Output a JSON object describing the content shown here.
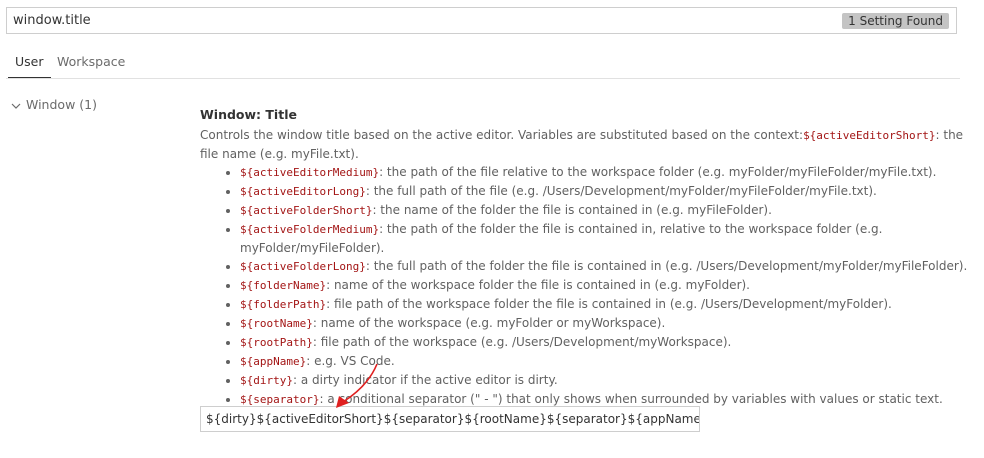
{
  "search": {
    "value": "window.title",
    "result_count": "1 Setting Found"
  },
  "tabs": [
    {
      "label": "User",
      "active": true
    },
    {
      "label": "Workspace",
      "active": false
    }
  ],
  "tree": {
    "label": "Window (1)"
  },
  "setting": {
    "title_prefix": "Window: ",
    "title": "Title",
    "desc_part1": "Controls the window title based on the active editor. Variables are substituted based on the context:",
    "desc_code": "${activeEditorShort}",
    "desc_part2": ": the file name (e.g. myFile.txt).",
    "variables": [
      {
        "code": "${activeEditorMedium}",
        "text": ": the path of the file relative to the workspace folder (e.g. myFolder/myFileFolder/myFile.txt)."
      },
      {
        "code": "${activeEditorLong}",
        "text": ": the full path of the file (e.g. /Users/Development/myFolder/myFileFolder/myFile.txt)."
      },
      {
        "code": "${activeFolderShort}",
        "text": ": the name of the folder the file is contained in (e.g. myFileFolder)."
      },
      {
        "code": "${activeFolderMedium}",
        "text": ": the path of the folder the file is contained in, relative to the workspace folder (e.g. myFolder/myFileFolder)."
      },
      {
        "code": "${activeFolderLong}",
        "text": ": the full path of the folder the file is contained in (e.g. /Users/Development/myFolder/myFileFolder)."
      },
      {
        "code": "${folderName}",
        "text": ": name of the workspace folder the file is contained in (e.g. myFolder)."
      },
      {
        "code": "${folderPath}",
        "text": ": file path of the workspace folder the file is contained in (e.g. /Users/Development/myFolder)."
      },
      {
        "code": "${rootName}",
        "text": ": name of the workspace (e.g. myFolder or myWorkspace)."
      },
      {
        "code": "${rootPath}",
        "text": ": file path of the workspace (e.g. /Users/Development/myWorkspace)."
      },
      {
        "code": "${appName}",
        "text": ": e.g. VS Code."
      },
      {
        "code": "${dirty}",
        "text": ": a dirty indicator if the active editor is dirty."
      },
      {
        "code": "${separator}",
        "text": ": a conditional separator (\" - \") that only shows when surrounded by variables with values or static text."
      }
    ],
    "value": "${dirty}${activeEditorShort}${separator}${rootName}${separator}${appName}"
  },
  "colors": {
    "code": "#a31515",
    "badge": "#c4c4c4",
    "arrow": "#e02020"
  },
  "icons": {
    "tree_toggle": "chevron-down-icon"
  }
}
